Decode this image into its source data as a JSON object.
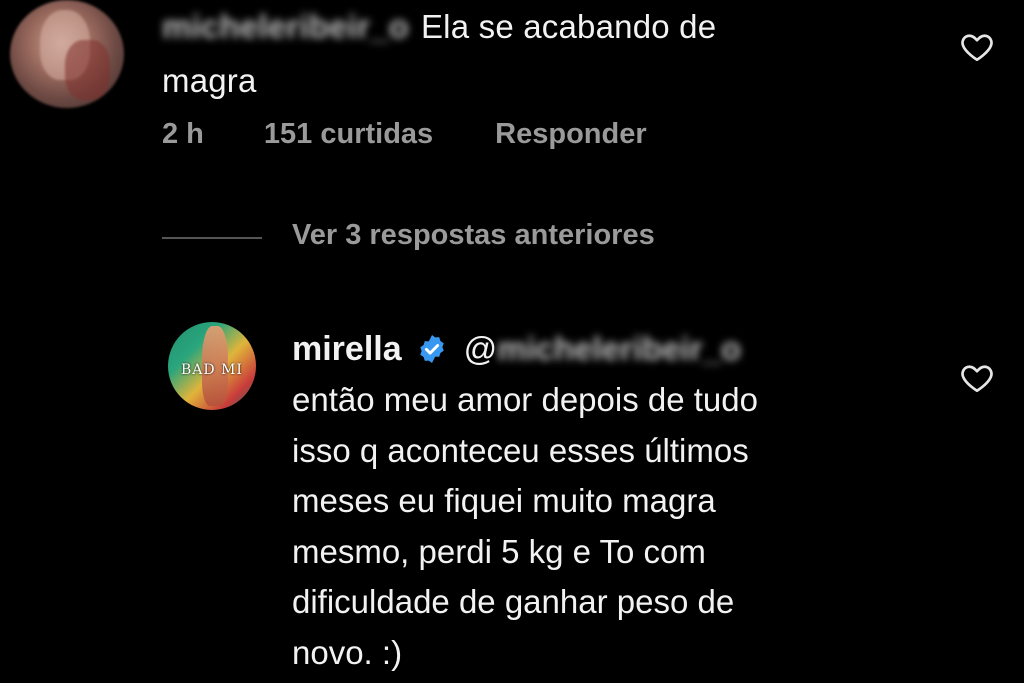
{
  "top_comment": {
    "username_blurred": "micheleribeir_o",
    "text_line1": "Ela se acabando de",
    "text_line2": "magra",
    "time": "2 h",
    "likes": "151 curtidas",
    "reply_label": "Responder",
    "like_icon": "heart-outline-icon"
  },
  "replies_toggle": {
    "label": "Ver 3 respostas anteriores"
  },
  "reply": {
    "username": "mirella",
    "verified_icon": "verified-badge-icon",
    "verified_color": "#3897f0",
    "mention_at": "@",
    "mention_blurred": "micheleribeir_o",
    "avatar_text": "BAD MI",
    "lines": [
      "então meu amor depois de tudo",
      "isso q aconteceu esses últimos",
      "meses eu fiquei muito magra",
      "mesmo, perdi 5 kg e To com",
      "dificuldade de ganhar peso de",
      "novo. :)"
    ],
    "like_icon": "heart-outline-icon"
  },
  "colors": {
    "background": "#000000",
    "text": "#f2f2f2",
    "muted": "#9a9a9a"
  }
}
